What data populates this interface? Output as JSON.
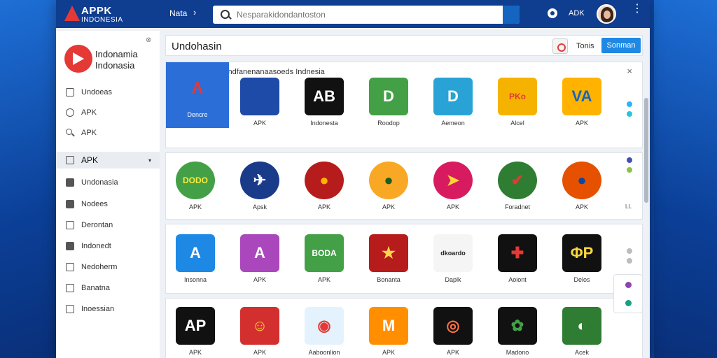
{
  "topbar": {
    "logo_line1": "APPK",
    "logo_line2": "INDONESIA",
    "nav_label": "Nata",
    "nav_chevron": "›",
    "search_placeholder": "Nesparakidondantoston",
    "right_label": "ADK",
    "kebab": "⋮"
  },
  "sidebar": {
    "close": "⊗",
    "brand_line1": "Indonamia",
    "brand_line2": "Indonasia",
    "items": [
      {
        "label": "Undoeas",
        "icon": "folder-icon"
      },
      {
        "label": "APK",
        "icon": "circle-icon"
      },
      {
        "label": "APK",
        "icon": "search-icon"
      },
      {
        "label": "APK",
        "icon": "folder-icon",
        "active": true
      },
      {
        "label": "Undonasia",
        "icon": "thumb-icon"
      },
      {
        "label": "Nodees",
        "icon": "card-icon"
      },
      {
        "label": "Derontan",
        "icon": "tag-icon"
      },
      {
        "label": "Indonedt",
        "icon": "trash-icon"
      },
      {
        "label": "Nedoherm",
        "icon": "chart-icon"
      },
      {
        "label": "Banatna",
        "icon": "list-icon"
      },
      {
        "label": "Inoessian",
        "icon": "home-icon"
      }
    ],
    "caret": "▾"
  },
  "content": {
    "title": "Undohasin",
    "title_text_btn": "Tonis",
    "primary_btn": "Sonman",
    "panel_heading": "Parats dna In Dondfanenanaasoeds Indnesia",
    "panel_close": "×",
    "row1": [
      {
        "name": "Dencre",
        "tile": "A",
        "bg": "#2b6ed8",
        "fg": "#e53935"
      },
      {
        "name": "APK",
        "tile": "",
        "bg": "#1e4aa8",
        "fg": "#ffffff"
      },
      {
        "name": "Indonesta",
        "tile": "AB",
        "bg": "#111111",
        "fg": "#ffffff"
      },
      {
        "name": "Roodop",
        "tile": "D",
        "bg": "#43a047",
        "fg": "#ffffff"
      },
      {
        "name": "Aemeon",
        "tile": "D",
        "bg": "#29a3d6",
        "fg": "#ffffff"
      },
      {
        "name": "Alcel",
        "tile": "PKo",
        "bg": "#f5b300",
        "fg": "#e53935"
      },
      {
        "name": "APK",
        "tile": "VA",
        "bg": "#ffb300",
        "fg": "#1565c0"
      }
    ],
    "row2": [
      {
        "name": "APK",
        "tile": "DODO",
        "bg": "#43a047",
        "fg": "#ffeb3b"
      },
      {
        "name": "Apsk",
        "tile": "✈",
        "bg": "#1a3a8a",
        "fg": "#ffffff"
      },
      {
        "name": "APK",
        "tile": "●",
        "bg": "#b71c1c",
        "fg": "#ffb300"
      },
      {
        "name": "APK",
        "tile": "●",
        "bg": "#f9a825",
        "fg": "#1b5e20"
      },
      {
        "name": "APK",
        "tile": "➤",
        "bg": "#d81b60",
        "fg": "#fdd835"
      },
      {
        "name": "Foradnet",
        "tile": "✔",
        "bg": "#2e7d32",
        "fg": "#e53935"
      },
      {
        "name": "APK",
        "tile": "●",
        "bg": "#e65100",
        "fg": "#0d47a1"
      }
    ],
    "row3": [
      {
        "name": "Insonna",
        "tile": "A",
        "bg": "#1e88e5",
        "fg": "#ffffff"
      },
      {
        "name": "APK",
        "tile": "A",
        "bg": "#ab47bc",
        "fg": "#ffffff"
      },
      {
        "name": "APK",
        "tile": "BODA",
        "bg": "#43a047",
        "fg": "#ffffff"
      },
      {
        "name": "Bonanta",
        "tile": "★",
        "bg": "#b71c1c",
        "fg": "#ffd54f"
      },
      {
        "name": "Daplk",
        "tile": "dkoardo",
        "bg": "#f5f5f5",
        "fg": "#222222"
      },
      {
        "name": "Aoiont",
        "tile": "✚",
        "bg": "#111111",
        "fg": "#e53935"
      },
      {
        "name": "Delos",
        "tile": "ΦP",
        "bg": "#111111",
        "fg": "#fdd835"
      }
    ],
    "row4": [
      {
        "name": "APK",
        "tile": "AP",
        "bg": "#111111",
        "fg": "#ffffff"
      },
      {
        "name": "APK",
        "tile": "☺",
        "bg": "#d32f2f",
        "fg": "#fdd835"
      },
      {
        "name": "Aaboonlion",
        "tile": "◉",
        "bg": "#e3f2fd",
        "fg": "#e53935"
      },
      {
        "name": "APK",
        "tile": "M",
        "bg": "#ff8f00",
        "fg": "#ffffff"
      },
      {
        "name": "APK",
        "tile": "◎",
        "bg": "#111111",
        "fg": "#ff7043"
      },
      {
        "name": "Madono",
        "tile": "✿",
        "bg": "#111111",
        "fg": "#43a047"
      },
      {
        "name": "Acek",
        "tile": "◐",
        "bg": "#2e7d32",
        "fg": "#ffffff"
      }
    ],
    "row2_side": "LL"
  }
}
